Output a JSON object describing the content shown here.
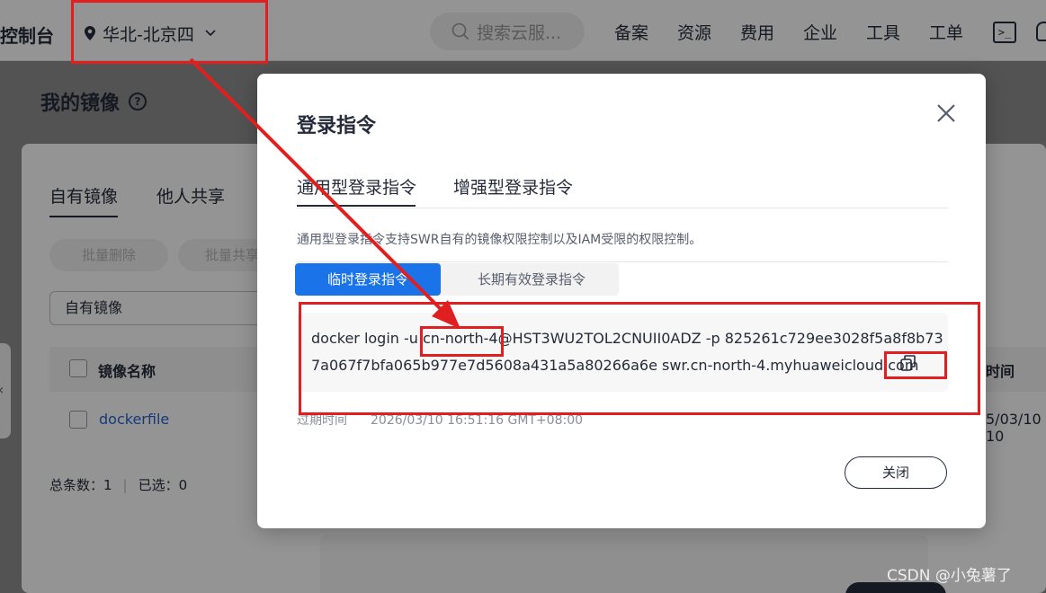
{
  "topbar": {
    "console": "控制台",
    "region": "华北-北京四",
    "search_placeholder": "搜索云服...",
    "nav": [
      "备案",
      "资源",
      "费用",
      "企业",
      "工具",
      "工单"
    ],
    "terminal_icon": ">_",
    "icons": [
      "location-pin-icon",
      "chevron-down-icon",
      "search-icon",
      "terminal-icon",
      "bell-icon"
    ]
  },
  "page": {
    "title": "我的镜像",
    "help_icon": "?",
    "tabs": [
      "自有镜像",
      "他人共享"
    ],
    "buttons": [
      "批量删除",
      "批量共享"
    ],
    "filter_value": "自有镜像",
    "table": {
      "headers": [
        "镜像名称",
        "时间"
      ],
      "rows": [
        {
          "name": "dockerfile",
          "time_fragment": "5/03/10 10"
        }
      ]
    },
    "footer": {
      "total": "总条数：1",
      "selected": "已选：0"
    }
  },
  "modal": {
    "title": "登录指令",
    "tabs": [
      "通用型登录指令",
      "增强型登录指令"
    ],
    "description": "通用型登录指令支持SWR自有的镜像权限控制以及IAM受限的权限控制。",
    "segment": {
      "active": "临时登录指令",
      "inactive": "长期有效登录指令"
    },
    "command_line1": "docker login -u cn-north-4@HST3WU2TOL2CNUII0ADZ -p 825261c729ee3028f5a8f8b73",
    "command_line2": "7a067f7bfa065b977e7d5608a431a5a80266a6e swr.cn-north-4.myhuaweicloud.com",
    "expire_label": "过期时间",
    "expire_value": "2026/03/10 16:51:16 GMT+08:00",
    "close_button": "关闭"
  },
  "watermark": "CSDN @小兔薯了",
  "colors": {
    "annotation": "#e02020",
    "primary": "#1a73e8",
    "link": "#2a62d1"
  }
}
